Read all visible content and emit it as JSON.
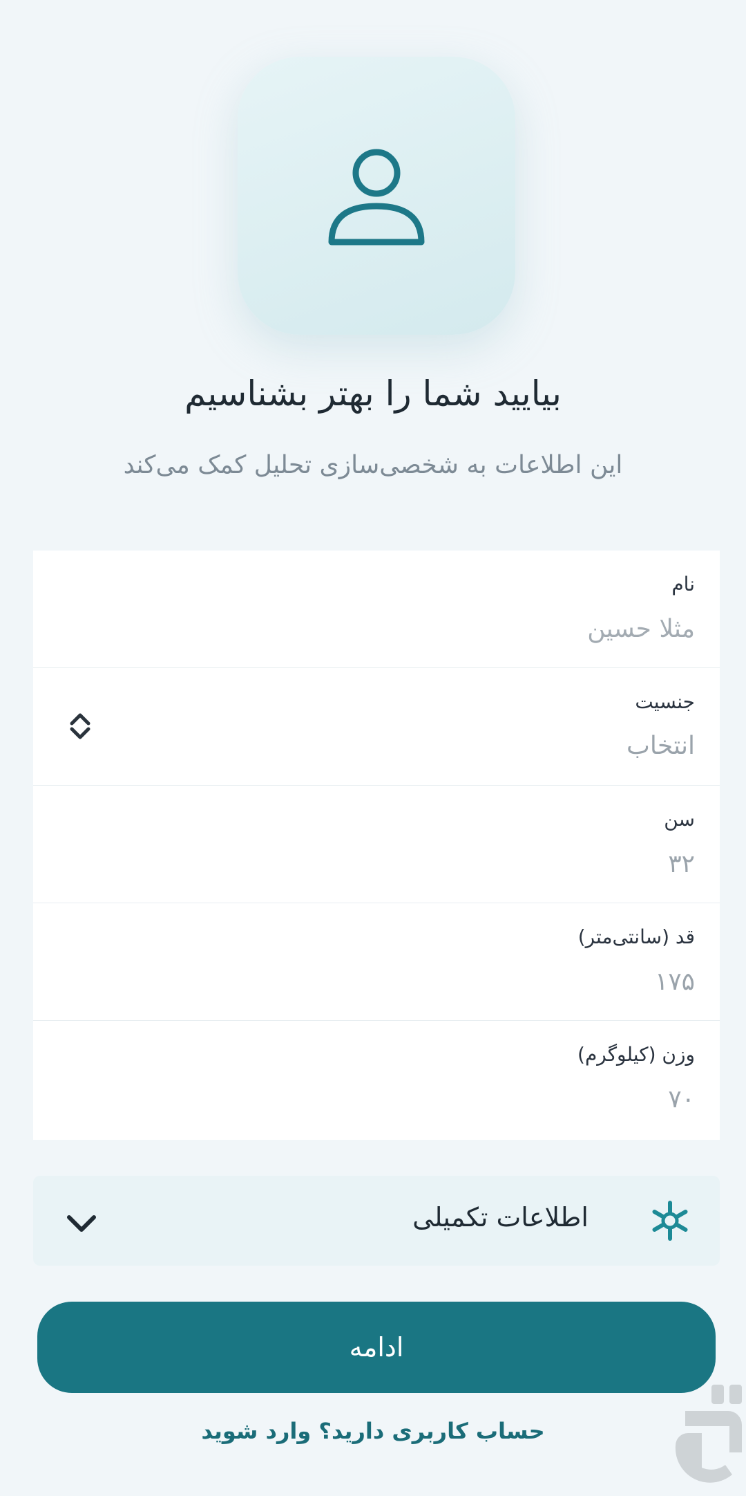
{
  "header": {
    "avatar_icon": "user-icon",
    "title": "بیایید شما را بهتر بشناسیم",
    "subtitle": "این اطلاعات به شخصی‌سازی تحلیل کمک می‌کند"
  },
  "form": {
    "name": {
      "label": "نام",
      "placeholder": "مثلا حسین",
      "value": ""
    },
    "gender": {
      "label": "جنسیت",
      "value": "انتخاب",
      "icon": "sort-chevrons-icon"
    },
    "age": {
      "label": "سن",
      "value": "۳۲"
    },
    "height": {
      "label": "قد (سانتی‌متر)",
      "value": "۱۷۵"
    },
    "weight": {
      "label": "وزن (کیلوگرم)",
      "value": "۷۰"
    }
  },
  "extra": {
    "label": "اطلاعات تکمیلی",
    "icon": "asterisk-icon",
    "toggle_icon": "chevron-down-icon"
  },
  "actions": {
    "continue_label": "ادامه",
    "login_link": "حساب کاربری دارید؟ وارد شوید"
  },
  "colors": {
    "accent": "#1a7683",
    "background": "#f1f6f9"
  }
}
